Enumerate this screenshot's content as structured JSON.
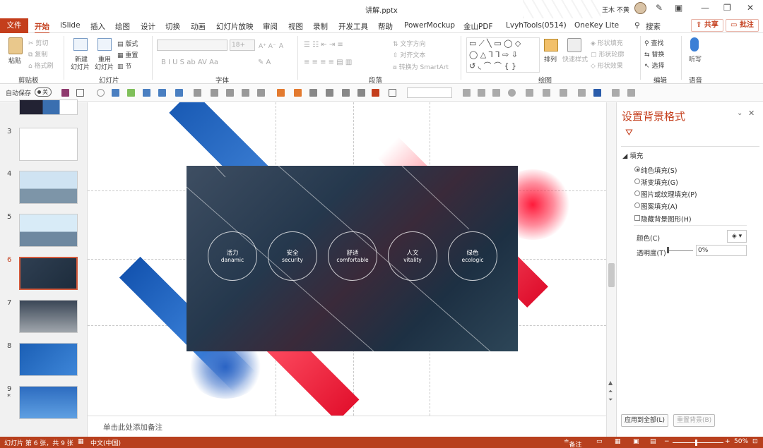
{
  "window": {
    "title": "讲解.pptx",
    "user": "王木 不黄"
  },
  "tabs": [
    "文件",
    "开始",
    "iSlide",
    "插入",
    "绘图",
    "设计",
    "切换",
    "动画",
    "幻灯片放映",
    "审阅",
    "视图",
    "录制",
    "开发工具",
    "帮助",
    "PowerMockup",
    "金山PDF",
    "LvyhTools(0514)",
    "OneKey Lite",
    "搜索"
  ],
  "tab_actions": {
    "share": "共享",
    "comment": "批注"
  },
  "ribbon": {
    "clipboard": {
      "label": "剪贴板",
      "paste": "粘贴",
      "cut": "剪切",
      "copy": "复制",
      "format_painter": "格式刷"
    },
    "slides": {
      "label": "幻灯片",
      "new_slide": "新建",
      "new_slide2": "幻灯片",
      "reuse": "重用",
      "reuse2": "幻灯片",
      "layout": "版式",
      "reset": "重置",
      "section": "节"
    },
    "font": {
      "label": "字体",
      "size": "18+"
    },
    "paragraph": {
      "label": "段落",
      "text_direction": "文字方向",
      "align_text": "对齐文本",
      "smartart": "转换为 SmartArt"
    },
    "drawing": {
      "label": "绘图",
      "arrange": "排列",
      "quick_styles": "快速样式",
      "shape_fill": "形状填充",
      "shape_outline": "形状轮廓",
      "shape_effects": "形状效果"
    },
    "editing": {
      "label": "编辑",
      "find": "查找",
      "replace": "替换",
      "select": "选择"
    },
    "voice": {
      "label": "语音",
      "dictate": "听写"
    }
  },
  "qat": {
    "autosave": "自动保存",
    "autosave_state": "关"
  },
  "thumbnails": [
    {
      "num": "3",
      "star": ""
    },
    {
      "num": "4",
      "star": ""
    },
    {
      "num": "5",
      "star": ""
    },
    {
      "num": "6",
      "star": ""
    },
    {
      "num": "7",
      "star": ""
    },
    {
      "num": "8",
      "star": ""
    },
    {
      "num": "9",
      "star": "*"
    }
  ],
  "slide": {
    "circles": [
      {
        "zh": "活力",
        "en": "danamic"
      },
      {
        "zh": "安全",
        "en": "security"
      },
      {
        "zh": "舒适",
        "en": "comfortable"
      },
      {
        "zh": "人文",
        "en": "vitality"
      },
      {
        "zh": "绿色",
        "en": "ecologic"
      }
    ]
  },
  "notes": {
    "placeholder": "单击此处添加备注"
  },
  "pane": {
    "title": "设置背景格式",
    "section": "填充",
    "options": [
      "纯色填充(S)",
      "渐变填充(G)",
      "图片或纹理填充(P)",
      "图案填充(A)"
    ],
    "selected_option": 0,
    "hide_bg": "隐藏背景图形(H)",
    "color_label": "颜色(C)",
    "transparency_label": "透明度(T)",
    "transparency_value": "0%",
    "apply_all": "应用到全部(L)",
    "reset_bg": "重置背景(B)"
  },
  "status": {
    "slide": "幻灯片 第 6 张，共 9 张",
    "language": "中文(中国)",
    "notes": "备注",
    "zoom": "50%"
  },
  "colors": {
    "accent": "#c43e1c",
    "status": "#b8401e"
  }
}
